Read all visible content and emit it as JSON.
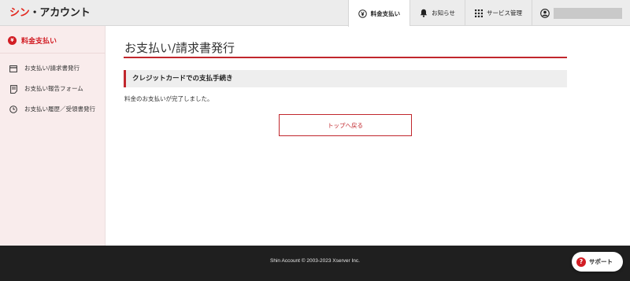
{
  "header": {
    "logo_part1": "シン",
    "logo_dot": "・",
    "logo_part2": "アカウント",
    "nav": [
      {
        "label": "料金支払い",
        "icon": "yen-circle-icon",
        "active": true
      },
      {
        "label": "お知らせ",
        "icon": "bell-icon"
      },
      {
        "label": "サービス管理",
        "icon": "grid-icon"
      }
    ],
    "user_icon": "user-circle-icon"
  },
  "sidebar": {
    "title": "料金支払い",
    "title_icon": "heart-yen-icon",
    "items": [
      {
        "label": "お支払い/請求書発行",
        "icon": "card-icon"
      },
      {
        "label": "お支払い報告フォーム",
        "icon": "form-icon"
      },
      {
        "label": "お支払い履歴／受領書発行",
        "icon": "clock-icon"
      }
    ]
  },
  "main": {
    "title": "お支払い/請求書発行",
    "section_title": "クレジットカードでの支払手続き",
    "message": "料金のお支払いが完了しました。",
    "back_button": "トップへ戻る"
  },
  "footer": {
    "copyright": "Shin Account © 2003-2023 Xserver Inc.",
    "support_label": "サポート"
  },
  "colors": {
    "accent": "#c1272d",
    "logo_red": "#e2271e",
    "sidebar_bg": "#f9ecec",
    "footer_bg": "#1f1f1f"
  }
}
